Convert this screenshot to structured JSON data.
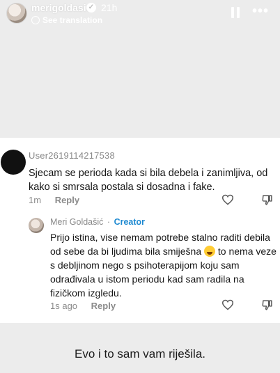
{
  "story": {
    "username": "merigoldasic",
    "time": "21h",
    "translate_label": "See translation",
    "icons": {
      "verified": "verified-badge-icon",
      "pause": "pause-icon",
      "more": "more-icon",
      "translate": "globe-icon"
    }
  },
  "comment": {
    "username": "User2619114217538",
    "text": "Sjecam se perioda kada si bila debela i zanimljiva, od kako si smrsala postala si dosadna i fake.",
    "time": "1m",
    "reply_label": "Reply"
  },
  "reply": {
    "author": "Meri Goldašić",
    "separator": "·",
    "badge": "Creator",
    "text_before_emoji": "Prijo istina, vise nemam potrebe stalno raditi debila od sebe da bi ljudima bila smiješna",
    "text_after_emoji": "to nema veze s debljinom nego s psihoterapijom koju sam odrađivala u istom periodu kad sam radila na fizičkom izgledu.",
    "emoji": "laughing-emoji",
    "time": "1s ago",
    "reply_label": "Reply"
  },
  "caption": "Evo i to sam vam riješila.",
  "colors": {
    "background": "#ececec",
    "card": "#ffffff",
    "creator": "#1f8ad1",
    "meta": "#8a8a8a"
  }
}
